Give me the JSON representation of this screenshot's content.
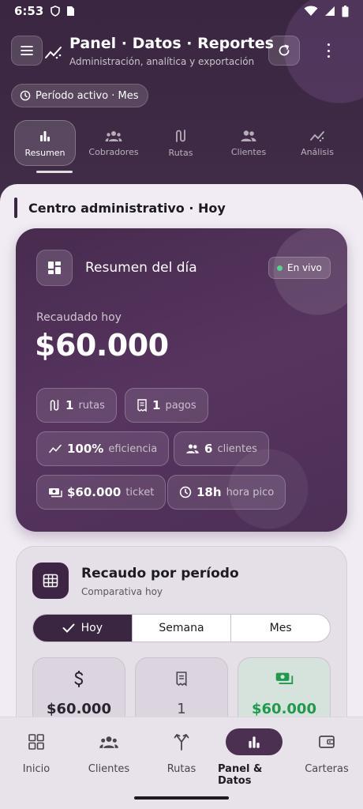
{
  "status_bar": {
    "time": "6:53"
  },
  "header": {
    "title": "Panel · Datos · Reportes",
    "subtitle": "Administración, analítica y exportación",
    "period_chip": "Período activo · Mes"
  },
  "tabs": [
    {
      "label": "Resumen",
      "icon": "bar-chart-icon"
    },
    {
      "label": "Cobradores",
      "icon": "groups-icon"
    },
    {
      "label": "Rutas",
      "icon": "route-icon"
    },
    {
      "label": "Clientes",
      "icon": "people-icon"
    },
    {
      "label": "Análisis",
      "icon": "trending-icon"
    }
  ],
  "section": {
    "title": "Centro administrativo · Hoy"
  },
  "summary": {
    "title": "Resumen del día",
    "live_badge": "En vivo",
    "amount_label": "Recaudado hoy",
    "amount": "$60.000",
    "stats": [
      {
        "value": "1",
        "label": "rutas",
        "icon": "route-icon"
      },
      {
        "value": "1",
        "label": "pagos",
        "icon": "receipt-icon"
      },
      {
        "value": "100%",
        "label": "eficiencia",
        "icon": "trending-icon"
      },
      {
        "value": "6",
        "label": "clientes",
        "icon": "people-icon"
      },
      {
        "value": "$60.000",
        "label": "ticket",
        "icon": "cash-icon"
      },
      {
        "value": "18h",
        "label": "hora pico",
        "icon": "clock-icon"
      }
    ]
  },
  "period": {
    "title": "Recaudo por período",
    "subtitle": "Comparativa hoy",
    "segments": [
      "Hoy",
      "Semana",
      "Mes"
    ],
    "selected": "Hoy",
    "cards": [
      {
        "value": "$60.000",
        "icon": "dollar-icon"
      },
      {
        "value": "1",
        "icon": "receipt-icon"
      },
      {
        "value": "$60.000",
        "icon": "cash-icon"
      }
    ]
  },
  "bottom_nav": [
    {
      "label": "Inicio",
      "icon": "grid-icon"
    },
    {
      "label": "Clientes",
      "icon": "groups-icon"
    },
    {
      "label": "Rutas",
      "icon": "fork-icon"
    },
    {
      "label": "Panel & Datos",
      "icon": "bar-chart-icon",
      "active": true
    },
    {
      "label": "Carteras",
      "icon": "wallet-icon"
    }
  ],
  "colors": {
    "header_bg": "#3a2640",
    "card_bg": "#4d2f56",
    "accent_green": "#1f9a4c",
    "live_dot": "#4cd98a"
  }
}
